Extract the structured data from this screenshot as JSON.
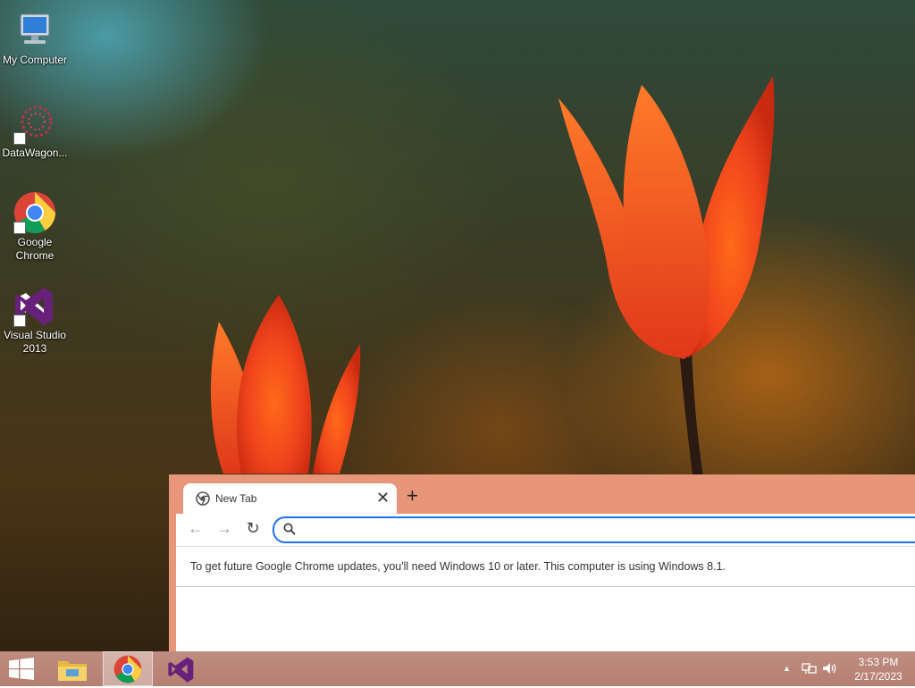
{
  "desktop": {
    "icons": [
      {
        "label": "My Computer",
        "icon": "computer-icon"
      },
      {
        "label": "DataWagon...",
        "icon": "datawagon-icon"
      },
      {
        "label": "Google Chrome",
        "icon": "chrome-icon"
      },
      {
        "label": "Visual Studio 2013",
        "icon": "visual-studio-icon"
      }
    ]
  },
  "chrome": {
    "tab_title": "New Tab",
    "tab_close": "✕",
    "new_tab": "+",
    "back": "←",
    "forward": "→",
    "reload": "↻",
    "omnibox_value": "",
    "infobar_text": "To get future Google Chrome updates, you'll need Windows 10 or later. This computer is using Windows 8.1."
  },
  "taskbar": {
    "items": [
      {
        "name": "start-button",
        "icon": "windows-logo-icon"
      },
      {
        "name": "file-explorer",
        "icon": "folder-icon"
      },
      {
        "name": "google-chrome",
        "icon": "chrome-icon",
        "active": true
      },
      {
        "name": "visual-studio",
        "icon": "visual-studio-icon"
      }
    ],
    "tray": {
      "show_hidden": "▲",
      "network_icon": "network-icon",
      "volume_icon": "speaker-icon"
    },
    "clock": {
      "time": "3:53 PM",
      "date": "2/17/2023"
    }
  },
  "colors": {
    "chrome_frame": "#e8967a",
    "omnibox_focus": "#1a73e8",
    "taskbar": "#b98678"
  }
}
